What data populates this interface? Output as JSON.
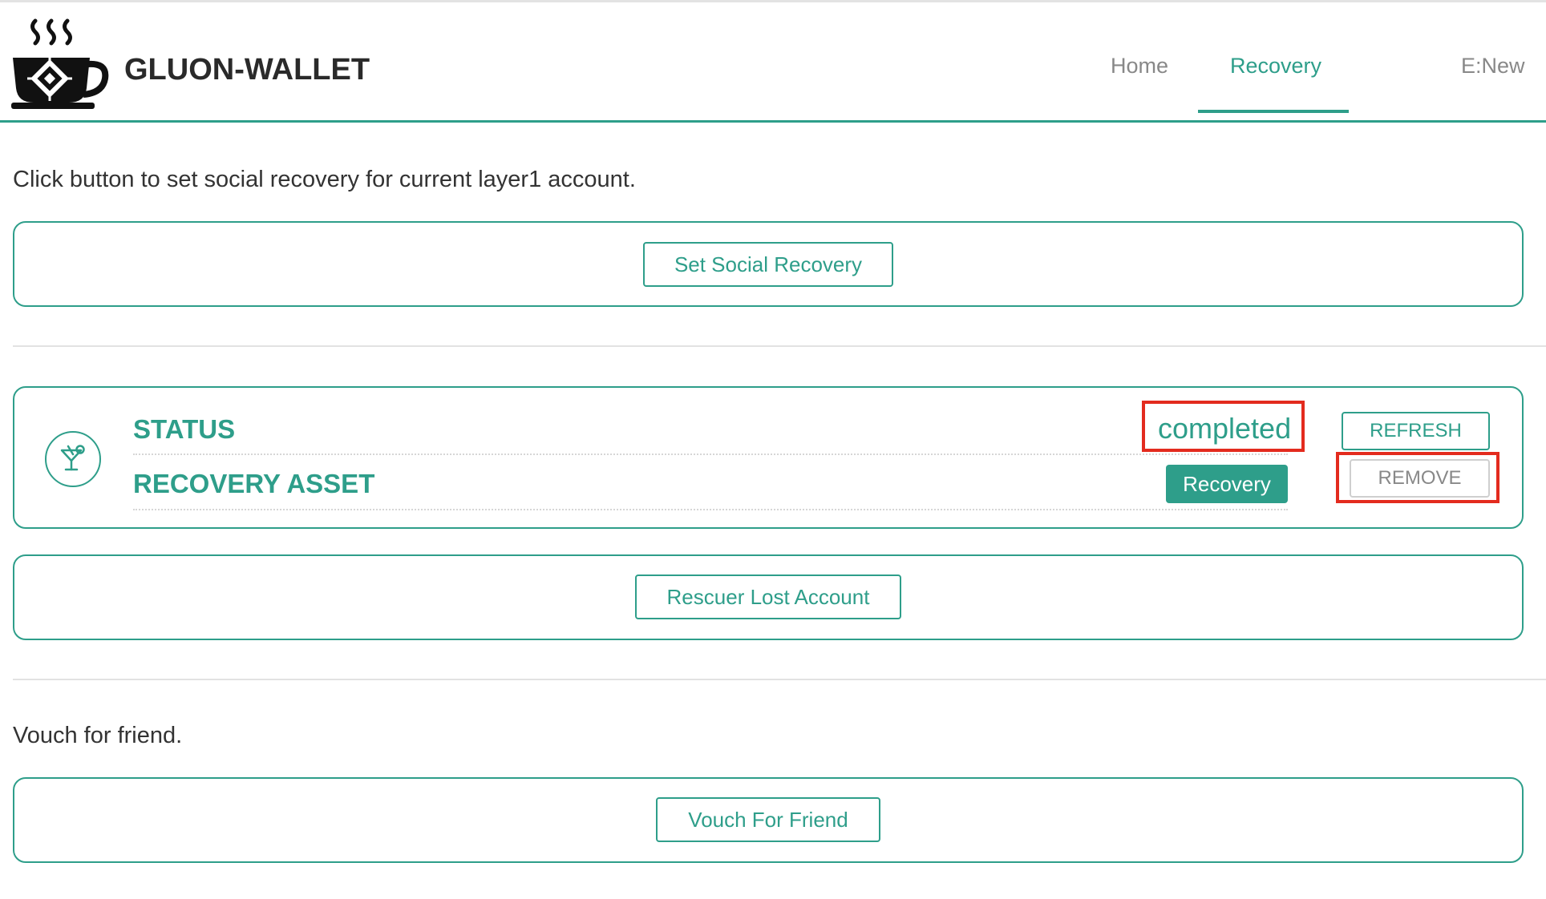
{
  "header": {
    "brand": "GLUON-WALLET",
    "logo_icon": "coffee-cup-chip-icon",
    "nav": [
      {
        "label": "Home",
        "active": false
      },
      {
        "label": "Recovery",
        "active": true
      },
      {
        "label": "E:New",
        "active": false
      }
    ]
  },
  "intro_text": "Click button to set social recovery for current layer1 account.",
  "set_social_recovery": {
    "label": "Set Social Recovery"
  },
  "status_card": {
    "icon": "cocktail-icon",
    "status_label": "STATUS",
    "status_value": "completed",
    "recovery_asset_label": "RECOVERY ASSET",
    "recovery_button": "Recovery",
    "refresh_button": "REFRESH",
    "remove_button": "REMOVE"
  },
  "rescuer": {
    "label": "Rescuer Lost Account"
  },
  "vouch": {
    "text": "Vouch for friend.",
    "button": "Vouch For Friend"
  },
  "colors": {
    "accent": "#2e9e8a",
    "highlight": "#e32b1e",
    "divider": "#e2e2e2"
  }
}
